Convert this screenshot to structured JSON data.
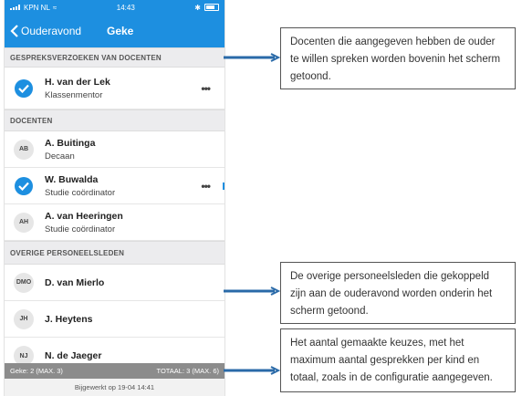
{
  "status_bar": {
    "carrier": "KPN NL",
    "time": "14:43"
  },
  "nav": {
    "back_label": "Ouderavond",
    "title": "Geke"
  },
  "sections": {
    "requests": {
      "header": "GESPREKSVERZOEKEN VAN DOCENTEN",
      "items": [
        {
          "name": "H. van der Lek",
          "role": "Klassenmentor"
        }
      ]
    },
    "teachers": {
      "header": "DOCENTEN",
      "items": [
        {
          "initials": "AB",
          "name": "A. Buitinga",
          "role": "Decaan"
        },
        {
          "name": "W. Buwalda",
          "role": "Studie coördinator"
        },
        {
          "initials": "AH",
          "name": "A. van Heeringen",
          "role": "Studie coördinator"
        }
      ]
    },
    "other": {
      "header": "OVERIGE PERSONEELSLEDEN",
      "items": [
        {
          "initials": "DMO",
          "name": "D. van Mierlo"
        },
        {
          "initials": "JH",
          "name": "J. Heytens"
        },
        {
          "initials": "NJ",
          "name": "N. de Jaeger"
        }
      ]
    }
  },
  "more_label": "•••",
  "footer": {
    "left": "Geke: 2 (MAX. 3)",
    "right": "TOTAAL: 3 (MAX. 6)",
    "updated": "Bijgewerkt op 19-04 14:41"
  },
  "callouts": [
    "Docenten die aangegeven hebben de ouder te willen spreken worden bovenin het scherm getoond.",
    "De overige personeelsleden die gekoppeld zijn aan de ouderavond worden onderin het scherm getoond.",
    "Het aantal gemaakte keuzes, met het maximum aantal gesprekken per kind en totaal, zoals in de configuratie aangegeven."
  ],
  "colors": {
    "accent": "#1d8fe0",
    "footer": "#8c8c8c"
  }
}
